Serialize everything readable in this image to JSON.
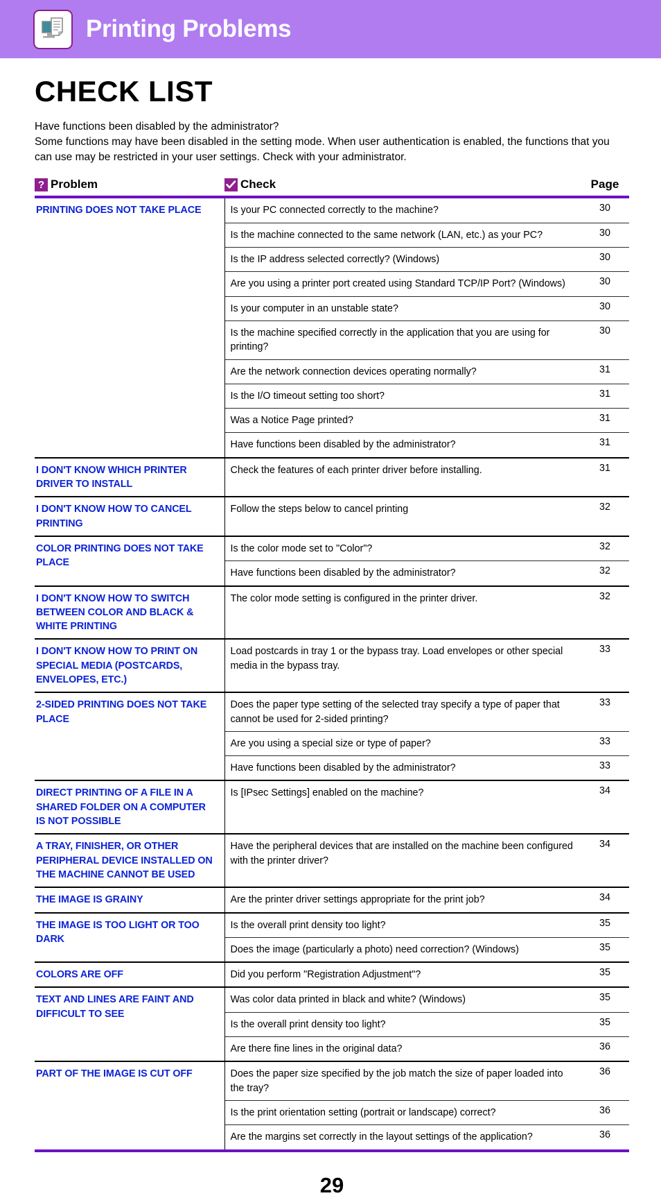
{
  "banner": {
    "title": "Printing Problems",
    "icon": "printer-document-icon",
    "bg_color": "#b07cf0"
  },
  "doc_title": "CHECK LIST",
  "intro": [
    "Have functions been disabled by the administrator?",
    "Some functions may have been disabled in the setting mode. When user authentication is enabled, the functions that you can use may be restricted in your user settings. Check with your administrator."
  ],
  "table": {
    "headers": {
      "problem": "Problem",
      "problem_icon": "question-mark-icon",
      "check": "Check",
      "check_icon": "checkmark-icon",
      "page": "Page"
    },
    "accent_color": "#6c10c4",
    "icon_color": "#8e1f8e",
    "problem_text_color": "#0b23d6",
    "groups": [
      {
        "problem": "PRINTING DOES NOT TAKE PLACE",
        "rows": [
          {
            "check": "Is your PC connected correctly to the machine?",
            "page": "30"
          },
          {
            "check": "Is the machine connected to the same network (LAN, etc.) as your PC?",
            "page": "30"
          },
          {
            "check": "Is the IP address selected correctly? (Windows)",
            "page": "30"
          },
          {
            "check": "Are you using a printer port created using Standard TCP/IP Port? (Windows)",
            "page": "30"
          },
          {
            "check": "Is your computer in an unstable state?",
            "page": "30"
          },
          {
            "check": "Is the machine specified correctly in the application that you are using for printing?",
            "page": "30"
          },
          {
            "check": "Are the network connection devices operating normally?",
            "page": "31"
          },
          {
            "check": "Is the I/O timeout setting too short?",
            "page": "31"
          },
          {
            "check": "Was a Notice Page printed?",
            "page": "31"
          },
          {
            "check": "Have functions been disabled by the administrator?",
            "page": "31"
          }
        ]
      },
      {
        "problem": "I DON'T KNOW WHICH PRINTER DRIVER TO INSTALL",
        "rows": [
          {
            "check": "Check the features of each printer driver before installing.",
            "page": "31"
          }
        ]
      },
      {
        "problem": "I DON'T KNOW HOW TO CANCEL PRINTING",
        "rows": [
          {
            "check": "Follow the steps below to cancel printing",
            "page": "32"
          }
        ]
      },
      {
        "problem": "COLOR PRINTING DOES NOT TAKE PLACE",
        "rows": [
          {
            "check": "Is the color mode set to \"Color\"?",
            "page": "32"
          },
          {
            "check": "Have functions been disabled by the administrator?",
            "page": "32"
          }
        ]
      },
      {
        "problem": "I DON'T KNOW HOW TO SWITCH BETWEEN COLOR AND BLACK & WHITE PRINTING",
        "rows": [
          {
            "check": "The color mode setting is configured in the printer driver.",
            "page": "32"
          }
        ]
      },
      {
        "problem": "I DON'T KNOW HOW TO PRINT ON SPECIAL MEDIA (POSTCARDS, ENVELOPES, ETC.)",
        "rows": [
          {
            "check": "Load postcards in tray 1 or the bypass tray. Load envelopes or other special media in the bypass tray.",
            "page": "33"
          }
        ]
      },
      {
        "problem": "2-SIDED PRINTING DOES NOT TAKE PLACE",
        "rows": [
          {
            "check": "Does the paper type setting of the selected tray specify a type of paper that cannot be used for 2-sided printing?",
            "page": "33"
          },
          {
            "check": "Are you using a special size or type of paper?",
            "page": "33"
          },
          {
            "check": "Have functions been disabled by the administrator?",
            "page": "33"
          }
        ]
      },
      {
        "problem": "DIRECT PRINTING OF A FILE IN A SHARED FOLDER ON A COMPUTER IS NOT POSSIBLE",
        "rows": [
          {
            "check": "Is [IPsec Settings] enabled on the machine?",
            "page": "34"
          }
        ]
      },
      {
        "problem": "A TRAY, FINISHER, OR OTHER PERIPHERAL DEVICE INSTALLED ON THE MACHINE CANNOT BE USED",
        "rows": [
          {
            "check": "Have the peripheral devices that are installed on the machine been configured with the printer driver?",
            "page": "34"
          }
        ]
      },
      {
        "problem": "THE IMAGE IS GRAINY",
        "rows": [
          {
            "check": "Are the printer driver settings appropriate for the print job?",
            "page": "34"
          }
        ]
      },
      {
        "problem": "THE IMAGE IS TOO LIGHT OR TOO DARK",
        "rows": [
          {
            "check": "Is the overall print density too light?",
            "page": "35"
          },
          {
            "check": "Does the image (particularly a photo) need correction? (Windows)",
            "page": "35"
          }
        ]
      },
      {
        "problem": "COLORS ARE OFF",
        "rows": [
          {
            "check": "Did you perform \"Registration Adjustment\"?",
            "page": "35"
          }
        ]
      },
      {
        "problem": "TEXT AND LINES ARE FAINT AND DIFFICULT TO SEE",
        "rows": [
          {
            "check": "Was color data printed in black and white? (Windows)",
            "page": "35"
          },
          {
            "check": "Is the overall print density too light?",
            "page": "35"
          },
          {
            "check": "Are there fine lines in the original data?",
            "page": "36"
          }
        ]
      },
      {
        "problem": "PART OF THE IMAGE IS CUT OFF",
        "rows": [
          {
            "check": "Does the paper size specified by the job match the size of paper loaded into the tray?",
            "page": "36"
          },
          {
            "check": "Is the print orientation setting (portrait or landscape) correct?",
            "page": "36"
          },
          {
            "check": "Are the margins set correctly in the layout settings of the application?",
            "page": "36"
          }
        ]
      }
    ]
  },
  "folio": "29"
}
